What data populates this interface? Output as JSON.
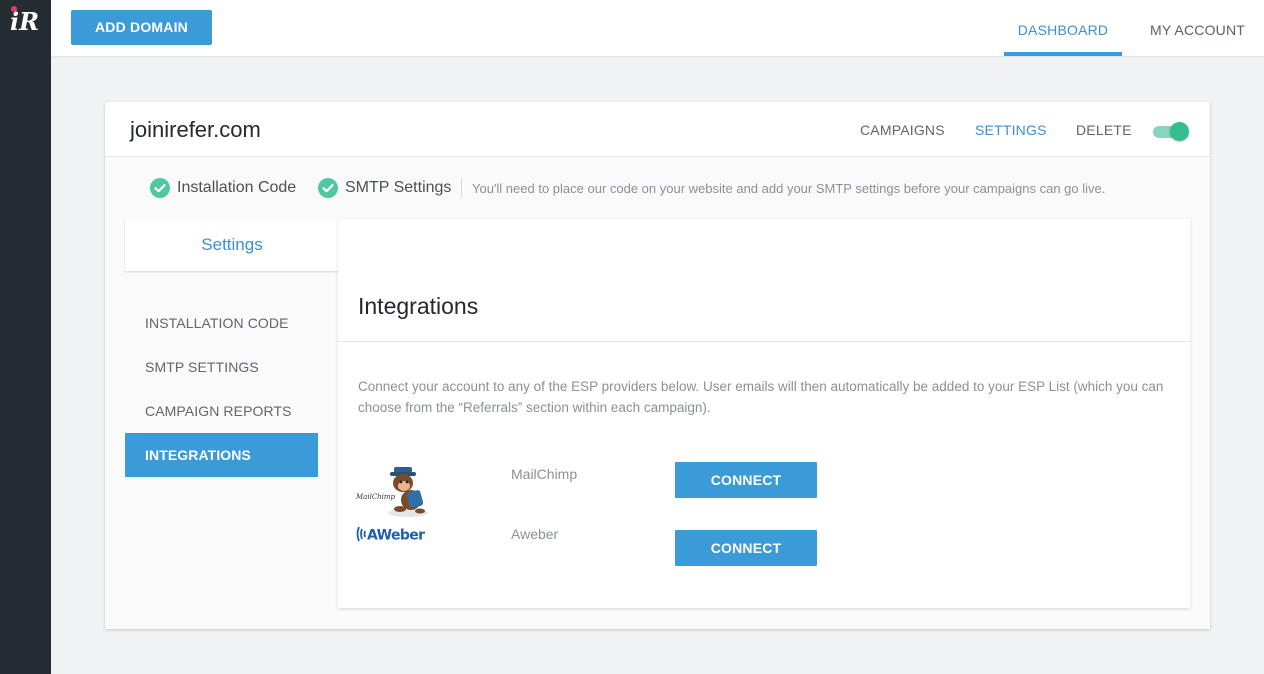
{
  "app": {
    "logo_text": "iR",
    "accent_color": "#3b9ad8",
    "success_color": "#35bd91"
  },
  "topbar": {
    "add_domain_label": "ADD DOMAIN",
    "nav": {
      "dashboard": "DASHBOARD",
      "my_account": "MY ACCOUNT"
    },
    "active_nav": "DASHBOARD"
  },
  "domain": {
    "name": "joinirefer.com",
    "tabs": {
      "campaigns": "CAMPAIGNS",
      "settings": "SETTINGS",
      "delete": "DELETE"
    },
    "active_tab": "SETTINGS",
    "toggle_on": true
  },
  "status": {
    "installation_code": "Installation Code",
    "smtp_settings": "SMTP Settings",
    "note": "You'll need to place our code on your website and add your SMTP settings before your campaigns can go live.",
    "icon": "check-circle-icon"
  },
  "settings_panel": {
    "title": "Settings",
    "menu": [
      "INSTALLATION CODE",
      "SMTP SETTINGS",
      "CAMPAIGN REPORTS",
      "INTEGRATIONS"
    ],
    "active_item": "INTEGRATIONS"
  },
  "integrations": {
    "title": "Integrations",
    "description": "Connect your account to any of the ESP providers below. User emails will then automatically be added to your ESP List (which you can choose from the “Referrals” section within each campaign).",
    "providers": [
      {
        "name": "MailChimp",
        "logo_icon": "mailchimp-logo",
        "logo_text": "MailChimp",
        "button_label": "CONNECT"
      },
      {
        "name": "Aweber",
        "logo_icon": "aweber-logo",
        "logo_text": "AWeber",
        "button_label": "CONNECT"
      }
    ]
  }
}
